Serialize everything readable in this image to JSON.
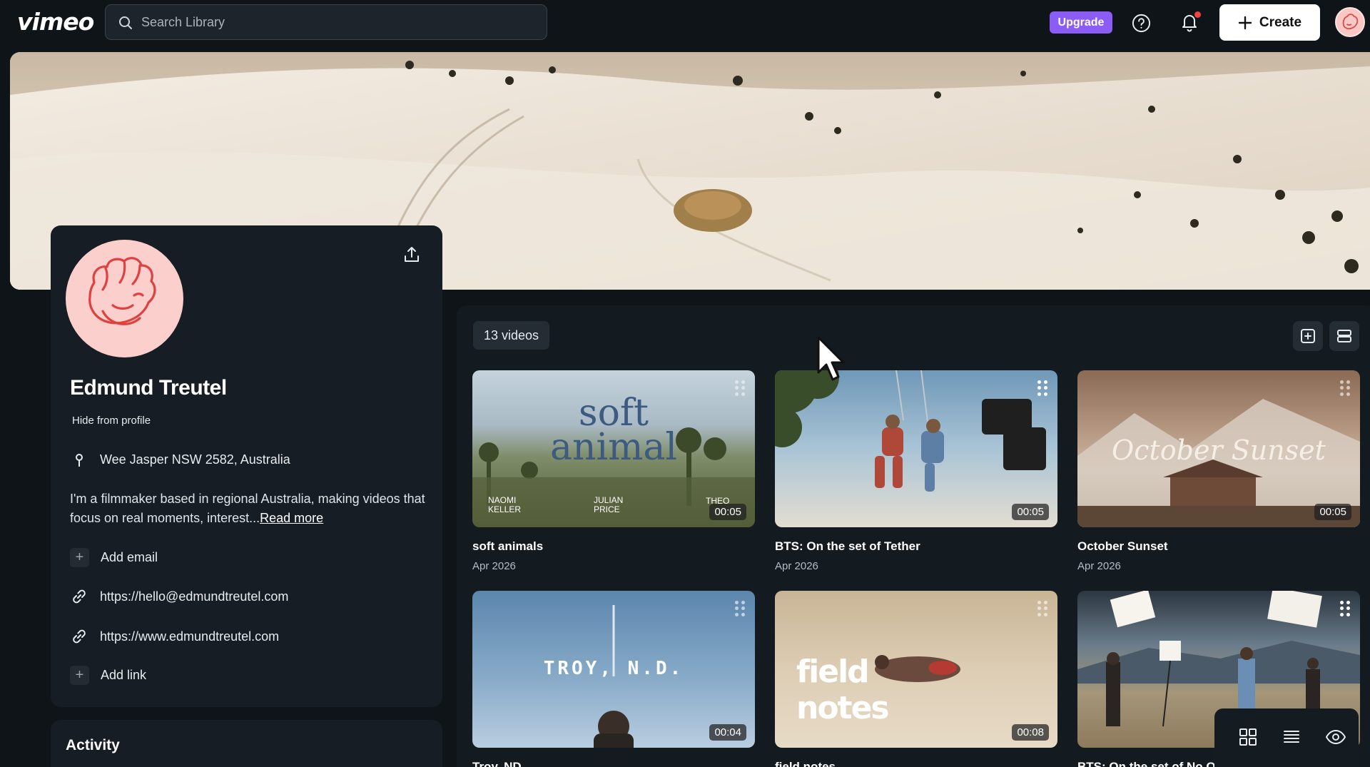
{
  "app": {
    "logo": "vimeo"
  },
  "search": {
    "placeholder": "Search Library"
  },
  "header": {
    "upgrade_label": "Upgrade",
    "create_label": "Create"
  },
  "profile": {
    "name": "Edmund Treutel",
    "hide_label": "Hide from profile",
    "location": "Wee Jasper NSW 2582, Australia",
    "bio": "I'm a filmmaker based in regional Australia, making videos that focus on real moments, interest...",
    "read_more": "Read more",
    "add_email": "Add email",
    "links": [
      "https://hello@edmundtreutel.com",
      "https://www.edmundtreutel.com"
    ],
    "add_link": "Add link"
  },
  "activity": {
    "title": "Activity"
  },
  "videos": {
    "count_label": "13 videos",
    "items": [
      {
        "title": "soft animals",
        "date": "Apr 2026",
        "duration": "00:05",
        "thumb_text": "soft animal",
        "credits": [
          "NAOMI KELLER",
          "JULIAN PRICE",
          "THEO"
        ]
      },
      {
        "title": "BTS: On the set of Tether",
        "date": "Apr 2026",
        "duration": "00:05"
      },
      {
        "title": "October Sunset",
        "date": "Apr 2026",
        "duration": "00:05",
        "thumb_text": "October Sunset"
      },
      {
        "title": "Troy, ND",
        "date": "",
        "duration": "00:04",
        "thumb_text": "TROY, N.D."
      },
      {
        "title": "field notes",
        "date": "",
        "duration": "00:08",
        "thumb_text": "field notes"
      },
      {
        "title": "BTS: On the set of No On...",
        "date": "",
        "duration": ""
      }
    ]
  },
  "colors": {
    "accent": "#8b5cf6",
    "background": "#0f1419",
    "panel": "#161d24",
    "notification": "#ef4444"
  }
}
